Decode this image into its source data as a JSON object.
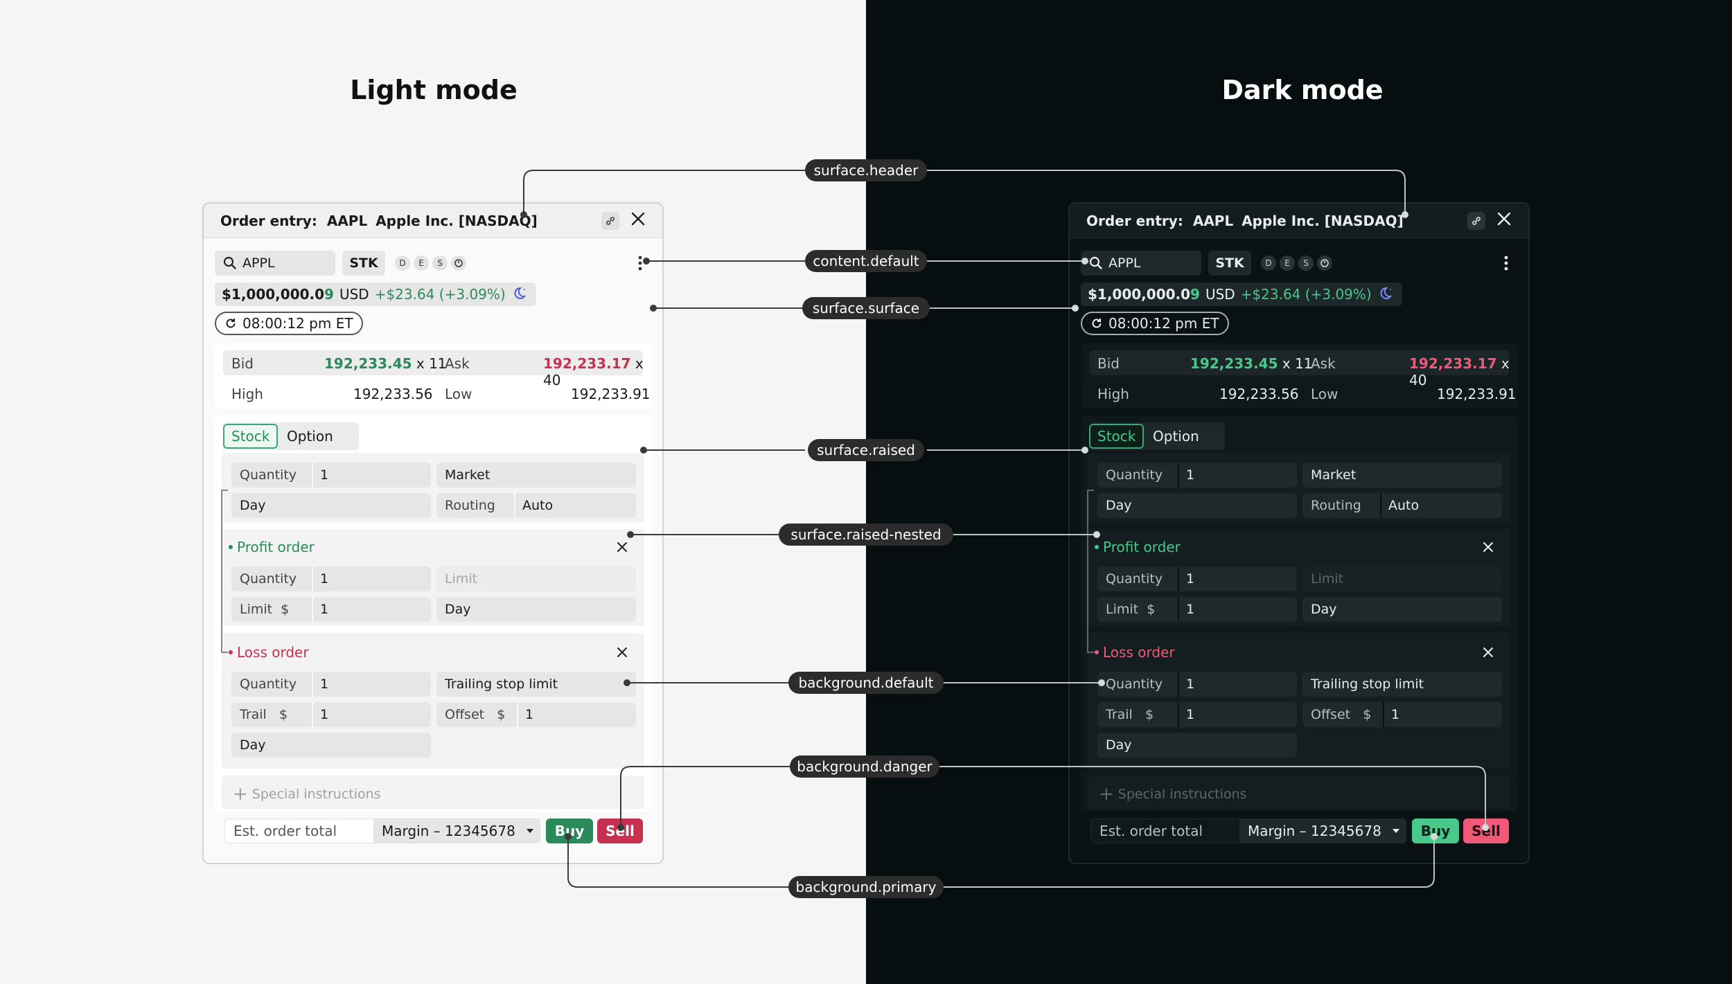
{
  "titles": {
    "light": "Light mode",
    "dark": "Dark mode"
  },
  "header": {
    "prefix": "Order entry:",
    "symbol": "AAPL",
    "name": "Apple Inc. [NASDAQ]"
  },
  "search": {
    "value": "APPL",
    "type_chip": "STK",
    "badges": [
      "D",
      "E",
      "S"
    ]
  },
  "account": {
    "balance_main": "$1,000,000.0",
    "balance_tail": "9",
    "currency": "USD",
    "change": "+$23.64 (+3.09%)"
  },
  "clock": "08:00:12 pm ET",
  "quote": {
    "bid_label": "Bid",
    "bid_price": "192,233.45",
    "bid_size": "x 11",
    "ask_label": "Ask",
    "ask_price": "192,233.17",
    "ask_size": "x 40",
    "high_label": "High",
    "high": "192,233.56",
    "low_label": "Low",
    "low": "192,233.91"
  },
  "tabs": [
    "Stock",
    "Option"
  ],
  "main_order": {
    "qty_label": "Quantity",
    "qty": "1",
    "order_type": "Market",
    "tif": "Day",
    "routing_label": "Routing",
    "routing": "Auto"
  },
  "profit": {
    "title": "Profit order",
    "qty_label": "Quantity",
    "qty": "1",
    "limit_placeholder": "Limit",
    "limit_label": "Limit",
    "currency": "$",
    "limit": "1",
    "tif": "Day"
  },
  "loss": {
    "title": "Loss order",
    "qty_label": "Quantity",
    "qty": "1",
    "order_type": "Trailing stop limit",
    "trail_label": "Trail",
    "currency": "$",
    "trail": "1",
    "offset_label": "Offset",
    "offset": "1",
    "tif": "Day"
  },
  "special": "Special instructions",
  "footer": {
    "total_label": "Est. order total",
    "account": "Margin – 12345678",
    "buy": "Buy",
    "sell": "Sell"
  },
  "tokens": {
    "surface_header": "surface.header",
    "content_default": "content.default",
    "surface_surface": "surface.surface",
    "surface_raised": "surface.raised",
    "surface_raised_nested": "surface.raised-nested",
    "background_default": "background.default",
    "background_danger": "background.danger",
    "background_primary": "background.primary"
  },
  "colors": {
    "primary_light": "#2a8a5a",
    "primary_dark": "#47c98a",
    "danger_light": "#c7304f",
    "danger_dark": "#f05a78"
  }
}
